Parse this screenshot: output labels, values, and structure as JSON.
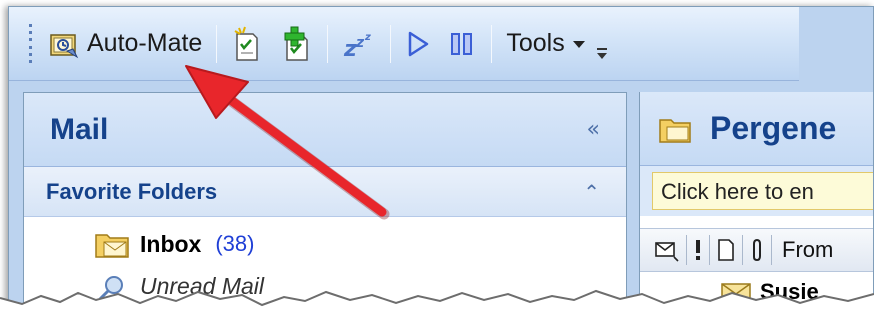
{
  "toolbar": {
    "automate_label": "Auto-Mate",
    "tools_label": "Tools"
  },
  "mail_pane": {
    "title": "Mail",
    "collapse_glyph": "«",
    "favorites_title": "Favorite Folders",
    "favorites_toggle_glyph": "⌃",
    "folders": [
      {
        "name": "Inbox",
        "count": "(38)"
      },
      {
        "name": "Unread Mail"
      }
    ]
  },
  "folder_pane": {
    "title": "Pergene",
    "search_placeholder": "Click here to en",
    "column_from": "From",
    "first_sender": "Susie"
  },
  "annotation": {
    "arrow_color": "#e8262b"
  },
  "icons": [
    "automate-icon",
    "new-task-icon",
    "add-task-icon",
    "sleep-icon",
    "play-icon",
    "pause-icon",
    "dropdown-arrow-icon",
    "toolbar-options-icon",
    "folder-icon",
    "search-folder-icon",
    "envelope-icon",
    "importance-icon",
    "document-icon",
    "attachment-icon"
  ]
}
